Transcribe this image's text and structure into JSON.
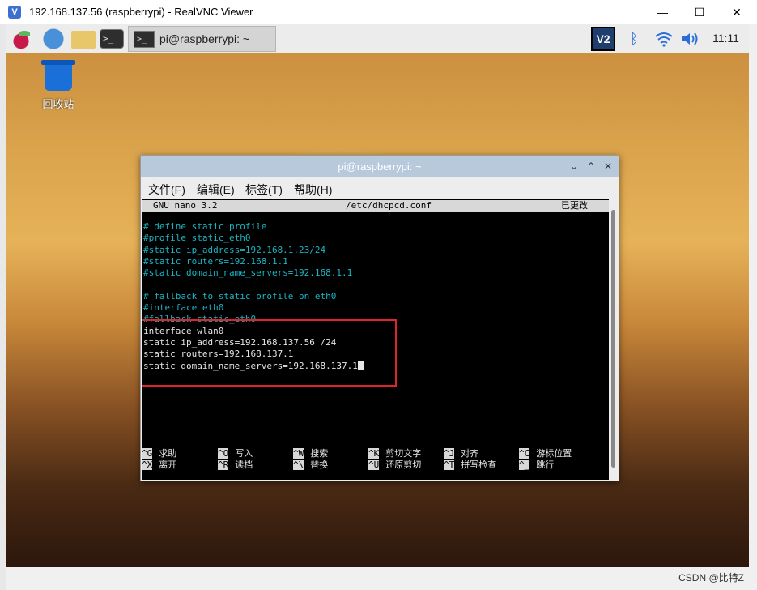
{
  "viewer": {
    "title": "192.168.137.56 (raspberrypi) - RealVNC Viewer",
    "app_icon": "V",
    "minimize": "—",
    "maximize": "☐",
    "close": "✕"
  },
  "panel": {
    "task_label": "pi@raspberrypi: ~",
    "term_glyph": ">_",
    "vnc_label": "V2",
    "clock": "11:11"
  },
  "desktop": {
    "trash_label": "回收站"
  },
  "terminal": {
    "title": "pi@raspberrypi: ~",
    "menus": [
      "文件(F)",
      "编辑(E)",
      "标签(T)",
      "帮助(H)"
    ],
    "nano": {
      "version": "GNU nano 3.2",
      "file": "/etc/dhcpcd.conf",
      "status": "已更改"
    },
    "lines": [
      {
        "text": "# define static profile",
        "color": "#1bb5c2"
      },
      {
        "text": "#profile static_eth0",
        "color": "#1bb5c2"
      },
      {
        "text": "#static ip_address=192.168.1.23/24",
        "color": "#1bb5c2"
      },
      {
        "text": "#static routers=192.168.1.1",
        "color": "#1bb5c2"
      },
      {
        "text": "#static domain_name_servers=192.168.1.1",
        "color": "#1bb5c2"
      },
      {
        "text": "",
        "color": "#1bb5c2"
      },
      {
        "text": "# fallback to static profile on eth0",
        "color": "#1bb5c2"
      },
      {
        "text": "#interface eth0",
        "color": "#1bb5c2"
      },
      {
        "text": "#fallback static_eth0",
        "color": "#1bb5c2"
      },
      {
        "text": "interface wlan0",
        "color": "#e6e6e6"
      },
      {
        "text": "static ip_address=192.168.137.56 /24",
        "color": "#e6e6e6"
      },
      {
        "text": "static routers=192.168.137.1",
        "color": "#e6e6e6"
      },
      {
        "text": "static domain_name_servers=192.168.137.1",
        "color": "#e6e6e6"
      }
    ],
    "shortcuts_row1": [
      {
        "key": "^G",
        "label": "求助"
      },
      {
        "key": "^O",
        "label": "写入"
      },
      {
        "key": "^W",
        "label": "搜索"
      },
      {
        "key": "^K",
        "label": "剪切文字"
      },
      {
        "key": "^J",
        "label": "对齐"
      },
      {
        "key": "^C",
        "label": "游标位置"
      }
    ],
    "shortcuts_row2": [
      {
        "key": "^X",
        "label": "离开"
      },
      {
        "key": "^R",
        "label": "读档"
      },
      {
        "key": "^\\",
        "label": "替换"
      },
      {
        "key": "^U",
        "label": "还原剪切"
      },
      {
        "key": "^T",
        "label": "拼写检查"
      },
      {
        "key": "^_",
        "label": "跳行"
      }
    ]
  },
  "watermark": "CSDN @比特Z",
  "colors": {
    "highlight": "#e0242c",
    "comment": "#1bb5c2"
  }
}
